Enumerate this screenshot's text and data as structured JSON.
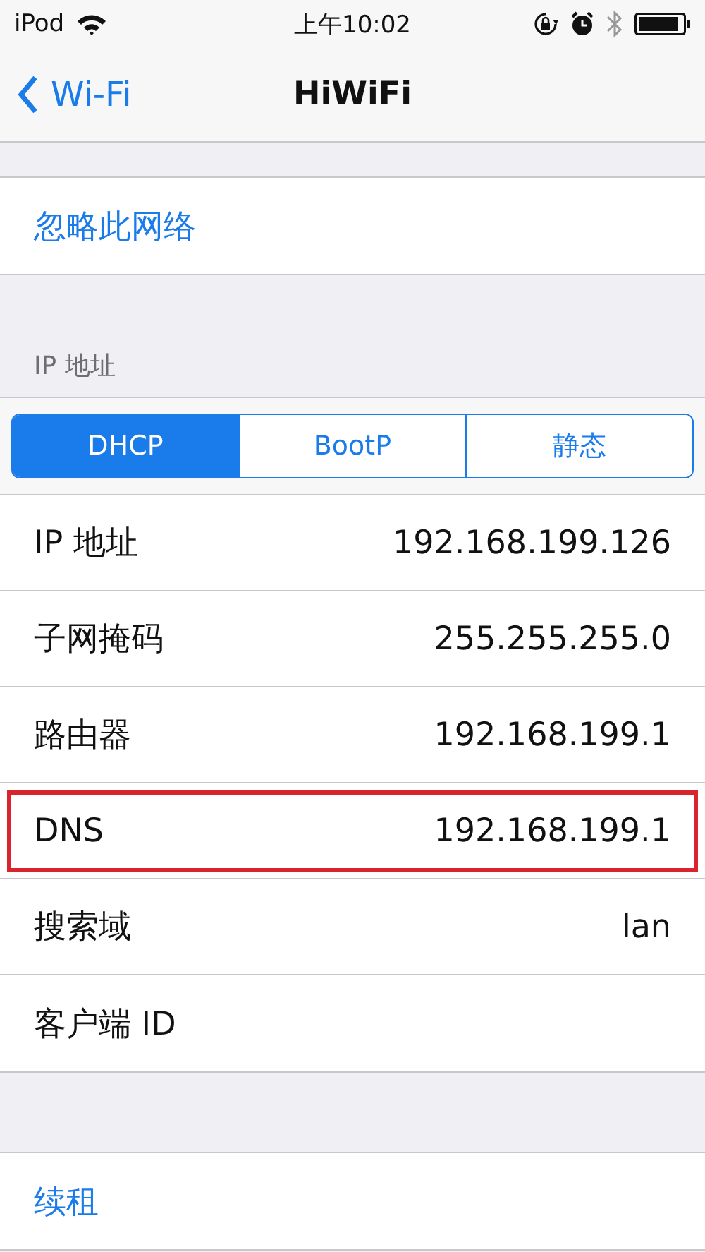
{
  "status_bar": {
    "carrier": "iPod",
    "time": "上午10:02"
  },
  "nav": {
    "back": "Wi-Fi",
    "title": "HiWiFi"
  },
  "forget": "忽略此网络",
  "section_header": "IP 地址",
  "segments": [
    {
      "label": "DHCP",
      "selected": true
    },
    {
      "label": "BootP",
      "selected": false
    },
    {
      "label": "静态",
      "selected": false
    }
  ],
  "rows": [
    {
      "label": "IP 地址",
      "value": "192.168.199.126",
      "highlighted": false
    },
    {
      "label": "子网掩码",
      "value": "255.255.255.0",
      "highlighted": false
    },
    {
      "label": "路由器",
      "value": "192.168.199.1",
      "highlighted": false
    },
    {
      "label": "DNS",
      "value": "192.168.199.1",
      "highlighted": true
    },
    {
      "label": "搜索域",
      "value": "lan",
      "highlighted": false
    },
    {
      "label": "客户端 ID",
      "highlighted": false
    }
  ],
  "renew": "续租"
}
